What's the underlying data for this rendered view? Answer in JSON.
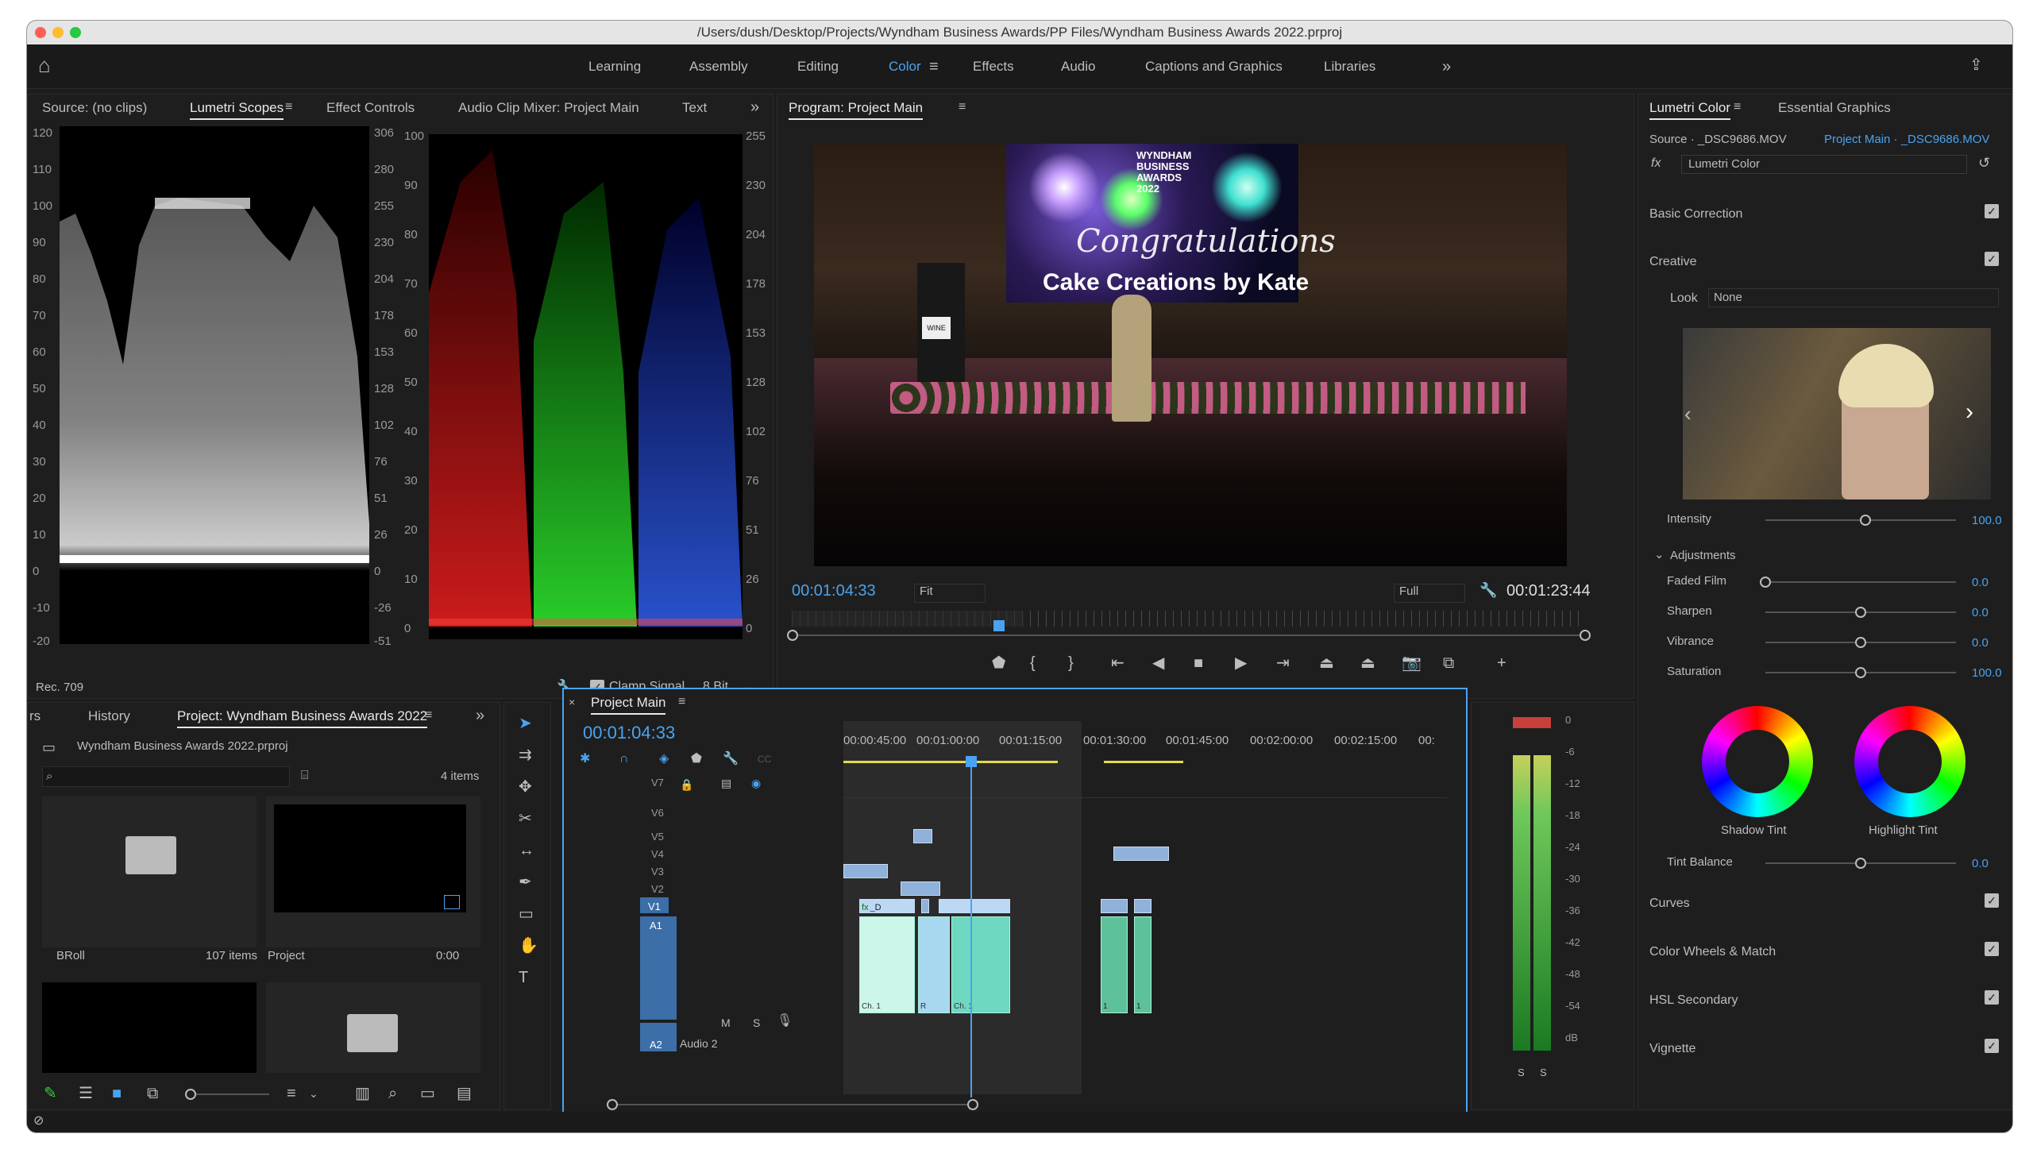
{
  "window": {
    "title": "/Users/dush/Desktop/Projects/Wyndham Business Awards/PP Files/Wyndham Business Awards 2022.prproj"
  },
  "workspaces": [
    "Learning",
    "Assembly",
    "Editing",
    "Color",
    "Effects",
    "Audio",
    "Captions and Graphics",
    "Libraries"
  ],
  "left_panel": {
    "tabs": [
      "Source: (no clips)",
      "Lumetri Scopes",
      "Effect Controls",
      "Audio Clip Mixer: Project Main",
      "Text"
    ],
    "wave_scale_left": [
      "120",
      "110",
      "100",
      "90",
      "80",
      "70",
      "60",
      "50",
      "40",
      "30",
      "20",
      "10",
      "0",
      "-10",
      "-20"
    ],
    "wave_scale_right": [
      "306",
      "280",
      "255",
      "230",
      "204",
      "178",
      "153",
      "128",
      "102",
      "76",
      "51",
      "26",
      "0",
      "-26",
      "-51"
    ],
    "parade_scale_left": [
      "100",
      "90",
      "80",
      "70",
      "60",
      "50",
      "40",
      "30",
      "20",
      "10",
      "0"
    ],
    "parade_scale_right": [
      "255",
      "230",
      "204",
      "178",
      "153",
      "128",
      "102",
      "76",
      "51",
      "26",
      "0"
    ],
    "rec": "Rec. 709",
    "clamp": "Clamp Signal",
    "bit": "8 Bit"
  },
  "program": {
    "title": "Program: Project Main",
    "timecode": "00:01:04:33",
    "fit": "Fit",
    "full": "Full",
    "duration": "00:01:23:44",
    "video_text": {
      "line1": "Congratulations",
      "line2": "Cake Creations by Kate",
      "logo": "WYNDHAM BUSINESS AWARDS 2022",
      "sign": "WINE"
    }
  },
  "lumetri": {
    "tabs": [
      "Lumetri Color",
      "Essential Graphics"
    ],
    "source": "Source · _DSC9686.MOV",
    "target": "Project Main · _DSC9686.MOV",
    "fx": "Lumetri Color",
    "basic": "Basic Correction",
    "creative": "Creative",
    "look_label": "Look",
    "look_value": "None",
    "intensity_label": "Intensity",
    "intensity_value": "100.0",
    "intensity": 1.0,
    "adjustments": "Adjustments",
    "sliders": [
      {
        "label": "Faded Film",
        "value": "0.0",
        "pos": 0.0
      },
      {
        "label": "Sharpen",
        "value": "0.0",
        "pos": 0.5
      },
      {
        "label": "Vibrance",
        "value": "0.0",
        "pos": 0.5
      },
      {
        "label": "Saturation",
        "value": "100.0",
        "pos": 0.5
      }
    ],
    "shadow_tint": "Shadow Tint",
    "highlight_tint": "Highlight Tint",
    "tint_balance": "Tint Balance",
    "tint_balance_value": "0.0",
    "sections": [
      "Curves",
      "Color Wheels & Match",
      "HSL Secondary",
      "Vignette"
    ]
  },
  "project": {
    "tabs": [
      "rs",
      "History",
      "Project: Wyndham Business Awards 2022"
    ],
    "file": "Wyndham Business Awards 2022.prproj",
    "count": "4 items",
    "items": [
      {
        "name": "BRoll",
        "meta": "107 items"
      },
      {
        "name": "Project",
        "meta": "0:00"
      }
    ]
  },
  "timeline": {
    "title": "Project Main",
    "timecode": "00:01:04:33",
    "ruler": [
      "00:00:45:00",
      "00:01:00:00",
      "00:01:15:00",
      "00:01:30:00",
      "00:01:45:00",
      "00:02:00:00",
      "00:02:15:00",
      "00:"
    ],
    "video_tracks": [
      "V7",
      "V6",
      "V5",
      "V4",
      "V3",
      "V2",
      "V1"
    ],
    "audio_tracks": [
      "A1",
      "A2"
    ],
    "audio2_name": "Audio 2",
    "clip_labels": [
      "fx",
      "_D",
      "Ch. 1",
      "Ch. 1",
      "R",
      "1",
      "1"
    ],
    "meter_scale": [
      "0",
      "-6",
      "-12",
      "-18",
      "-24",
      "-30",
      "-36",
      "-42",
      "-48",
      "-54",
      "dB"
    ],
    "meter_solo": [
      "S",
      "S"
    ],
    "track_buttons": [
      "M",
      "S"
    ]
  },
  "colors": {
    "accent": "#4aa3f0",
    "panel": "#1e1e1e",
    "app": "#1d1d1d"
  }
}
